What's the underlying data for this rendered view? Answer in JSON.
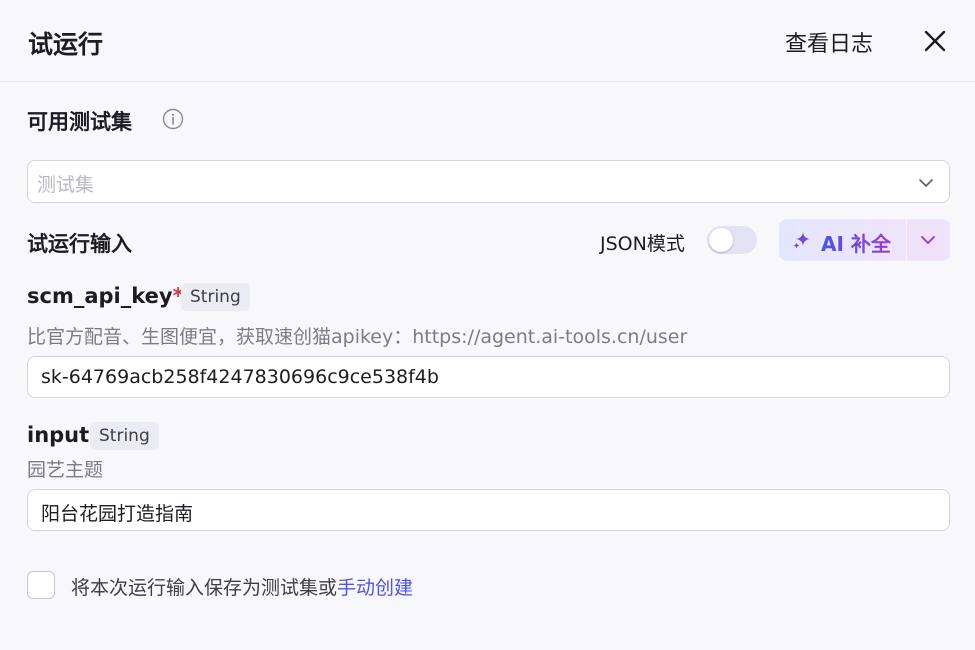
{
  "header": {
    "title": "试运行",
    "log_link": "查看日志"
  },
  "test_set": {
    "label": "可用测试集",
    "placeholder": "测试集"
  },
  "run_input": {
    "label": "试运行输入",
    "json_mode_label": "JSON模式",
    "json_mode_on": false,
    "ai_button_label": "AI 补全"
  },
  "fields": [
    {
      "name": "scm_api_key",
      "required_mark": "*",
      "type": "String",
      "description": "比官方配音、生图便宜，获取速创猫apikey：https://agent.ai-tools.cn/user",
      "value": "sk-64769acb258f4247830696c9ce538f4b"
    },
    {
      "name": "input",
      "type": "String",
      "description": "园艺主题",
      "value": "阳台花园打造指南"
    }
  ],
  "footer": {
    "save_text": "将本次运行输入保存为测试集或",
    "manual_link": "手动创建"
  },
  "colors": {
    "accent": "#4d53e8",
    "required": "#e5323b",
    "background": "#f8f8fc"
  }
}
